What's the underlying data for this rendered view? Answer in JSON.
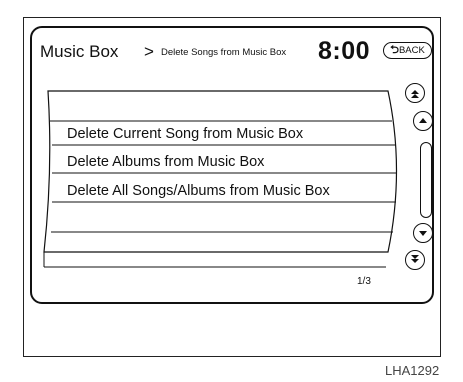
{
  "header": {
    "title": "Music Box",
    "separator": ">",
    "subtitle": "Delete Songs from Music Box",
    "clock": "8:00",
    "back_label": "BACK"
  },
  "menu": {
    "items": [
      {
        "label": ""
      },
      {
        "label": "Delete Current Song from Music Box"
      },
      {
        "label": "Delete Albums from Music Box"
      },
      {
        "label": "Delete All Songs/Albums from Music Box"
      },
      {
        "label": ""
      },
      {
        "label": ""
      }
    ],
    "page_indicator": "1/3"
  },
  "scroll": {
    "icons": [
      "page-up-icon",
      "scroll-up-icon",
      "scroll-down-icon",
      "page-down-icon"
    ],
    "position_fraction": 0.0
  },
  "figure_caption": "LHA1292"
}
